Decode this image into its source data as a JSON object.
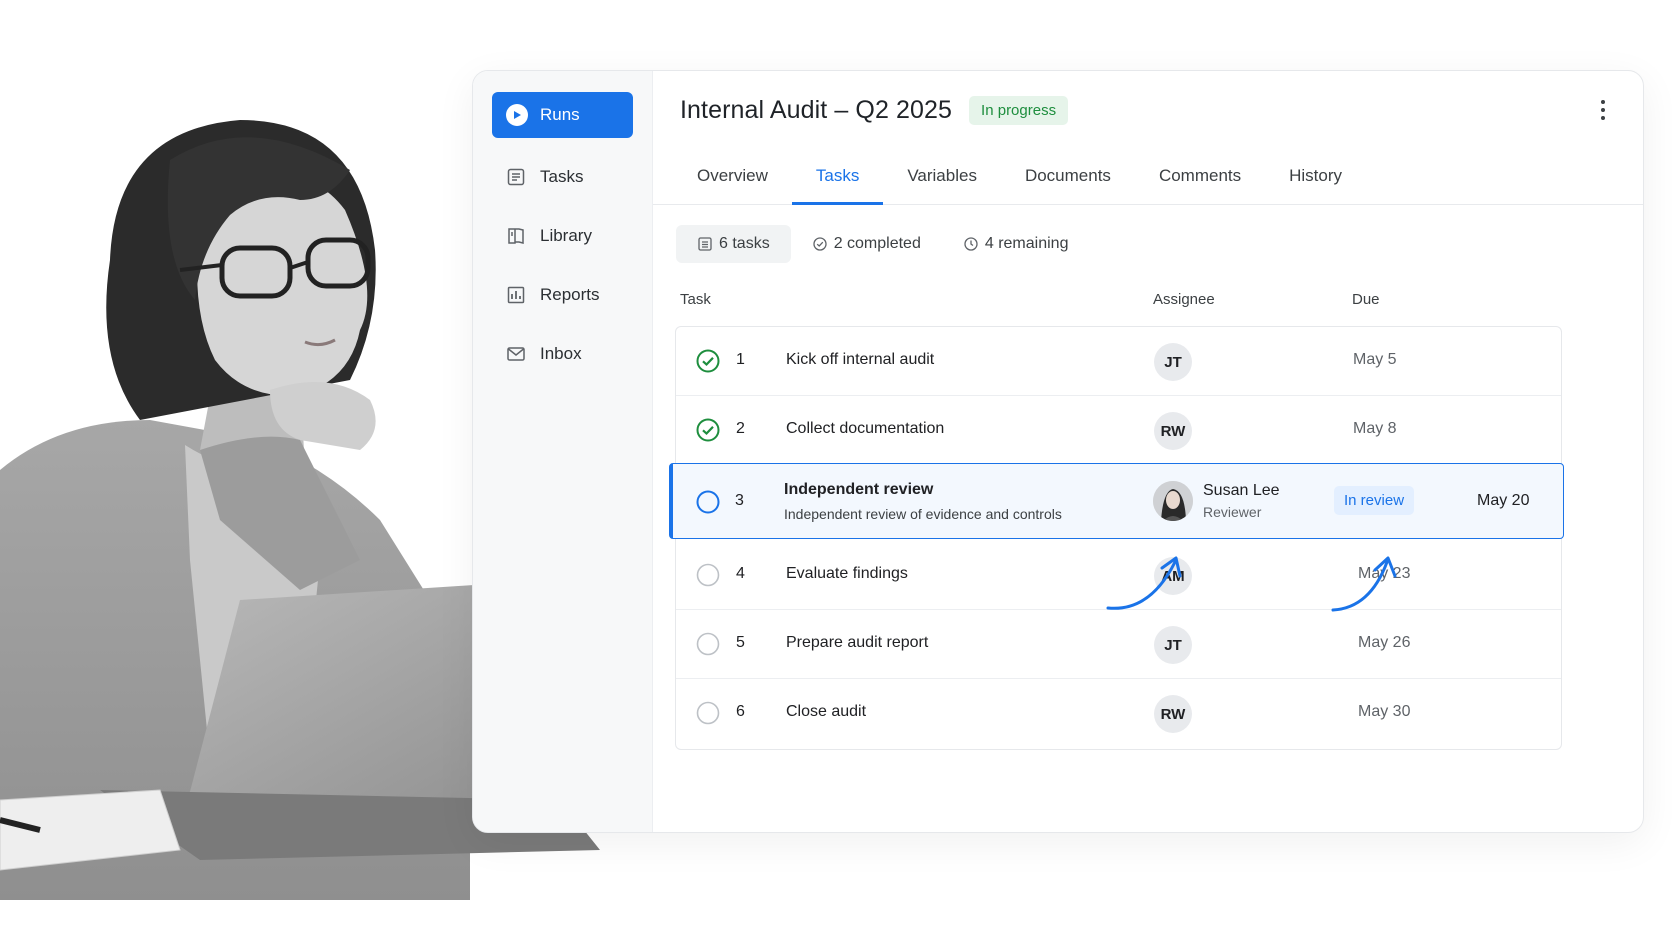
{
  "sidebar": {
    "items": [
      {
        "label": "Runs",
        "icon": "play-icon",
        "active": true
      },
      {
        "label": "Tasks",
        "icon": "tasks-icon"
      },
      {
        "label": "Library",
        "icon": "book-icon"
      },
      {
        "label": "Reports",
        "icon": "bar-chart-icon"
      },
      {
        "label": "Inbox",
        "icon": "mail-icon"
      }
    ]
  },
  "header": {
    "title": "Internal Audit – Q2 2025",
    "status": "In progress",
    "status_color": "#1e8e3e"
  },
  "tabs": [
    "Overview",
    "Tasks",
    "Variables",
    "Documents",
    "Comments",
    "History"
  ],
  "active_tab": "Tasks",
  "stats": {
    "total": "6 tasks",
    "completed": "2 completed",
    "remaining": "4 remaining"
  },
  "table": {
    "columns": {
      "task": "Task",
      "assignee": "Assignee",
      "due": "Due"
    },
    "rows": [
      {
        "num": "1",
        "name": "Kick off internal audit",
        "assignee": "JT",
        "due": "May 5",
        "done": true
      },
      {
        "num": "2",
        "name": "Collect documentation",
        "assignee": "RW",
        "due": "May 8",
        "done": true
      },
      {
        "num": "3",
        "name": "Independent review",
        "description": "Independent review of evidence and controls",
        "assignee_name": "Susan Lee",
        "assignee_role": "Reviewer",
        "badge": "In review",
        "due": "May 20",
        "selected": true
      },
      {
        "num": "4",
        "name": "Evaluate findings",
        "assignee": "AM",
        "due": "May 23",
        "done": false
      },
      {
        "num": "5",
        "name": "Prepare audit report",
        "assignee": "JT",
        "due": "May 26",
        "done": false
      },
      {
        "num": "6",
        "name": "Close audit",
        "assignee": "RW",
        "due": "May 30",
        "done": false
      }
    ]
  },
  "accent": "#1a73e8"
}
